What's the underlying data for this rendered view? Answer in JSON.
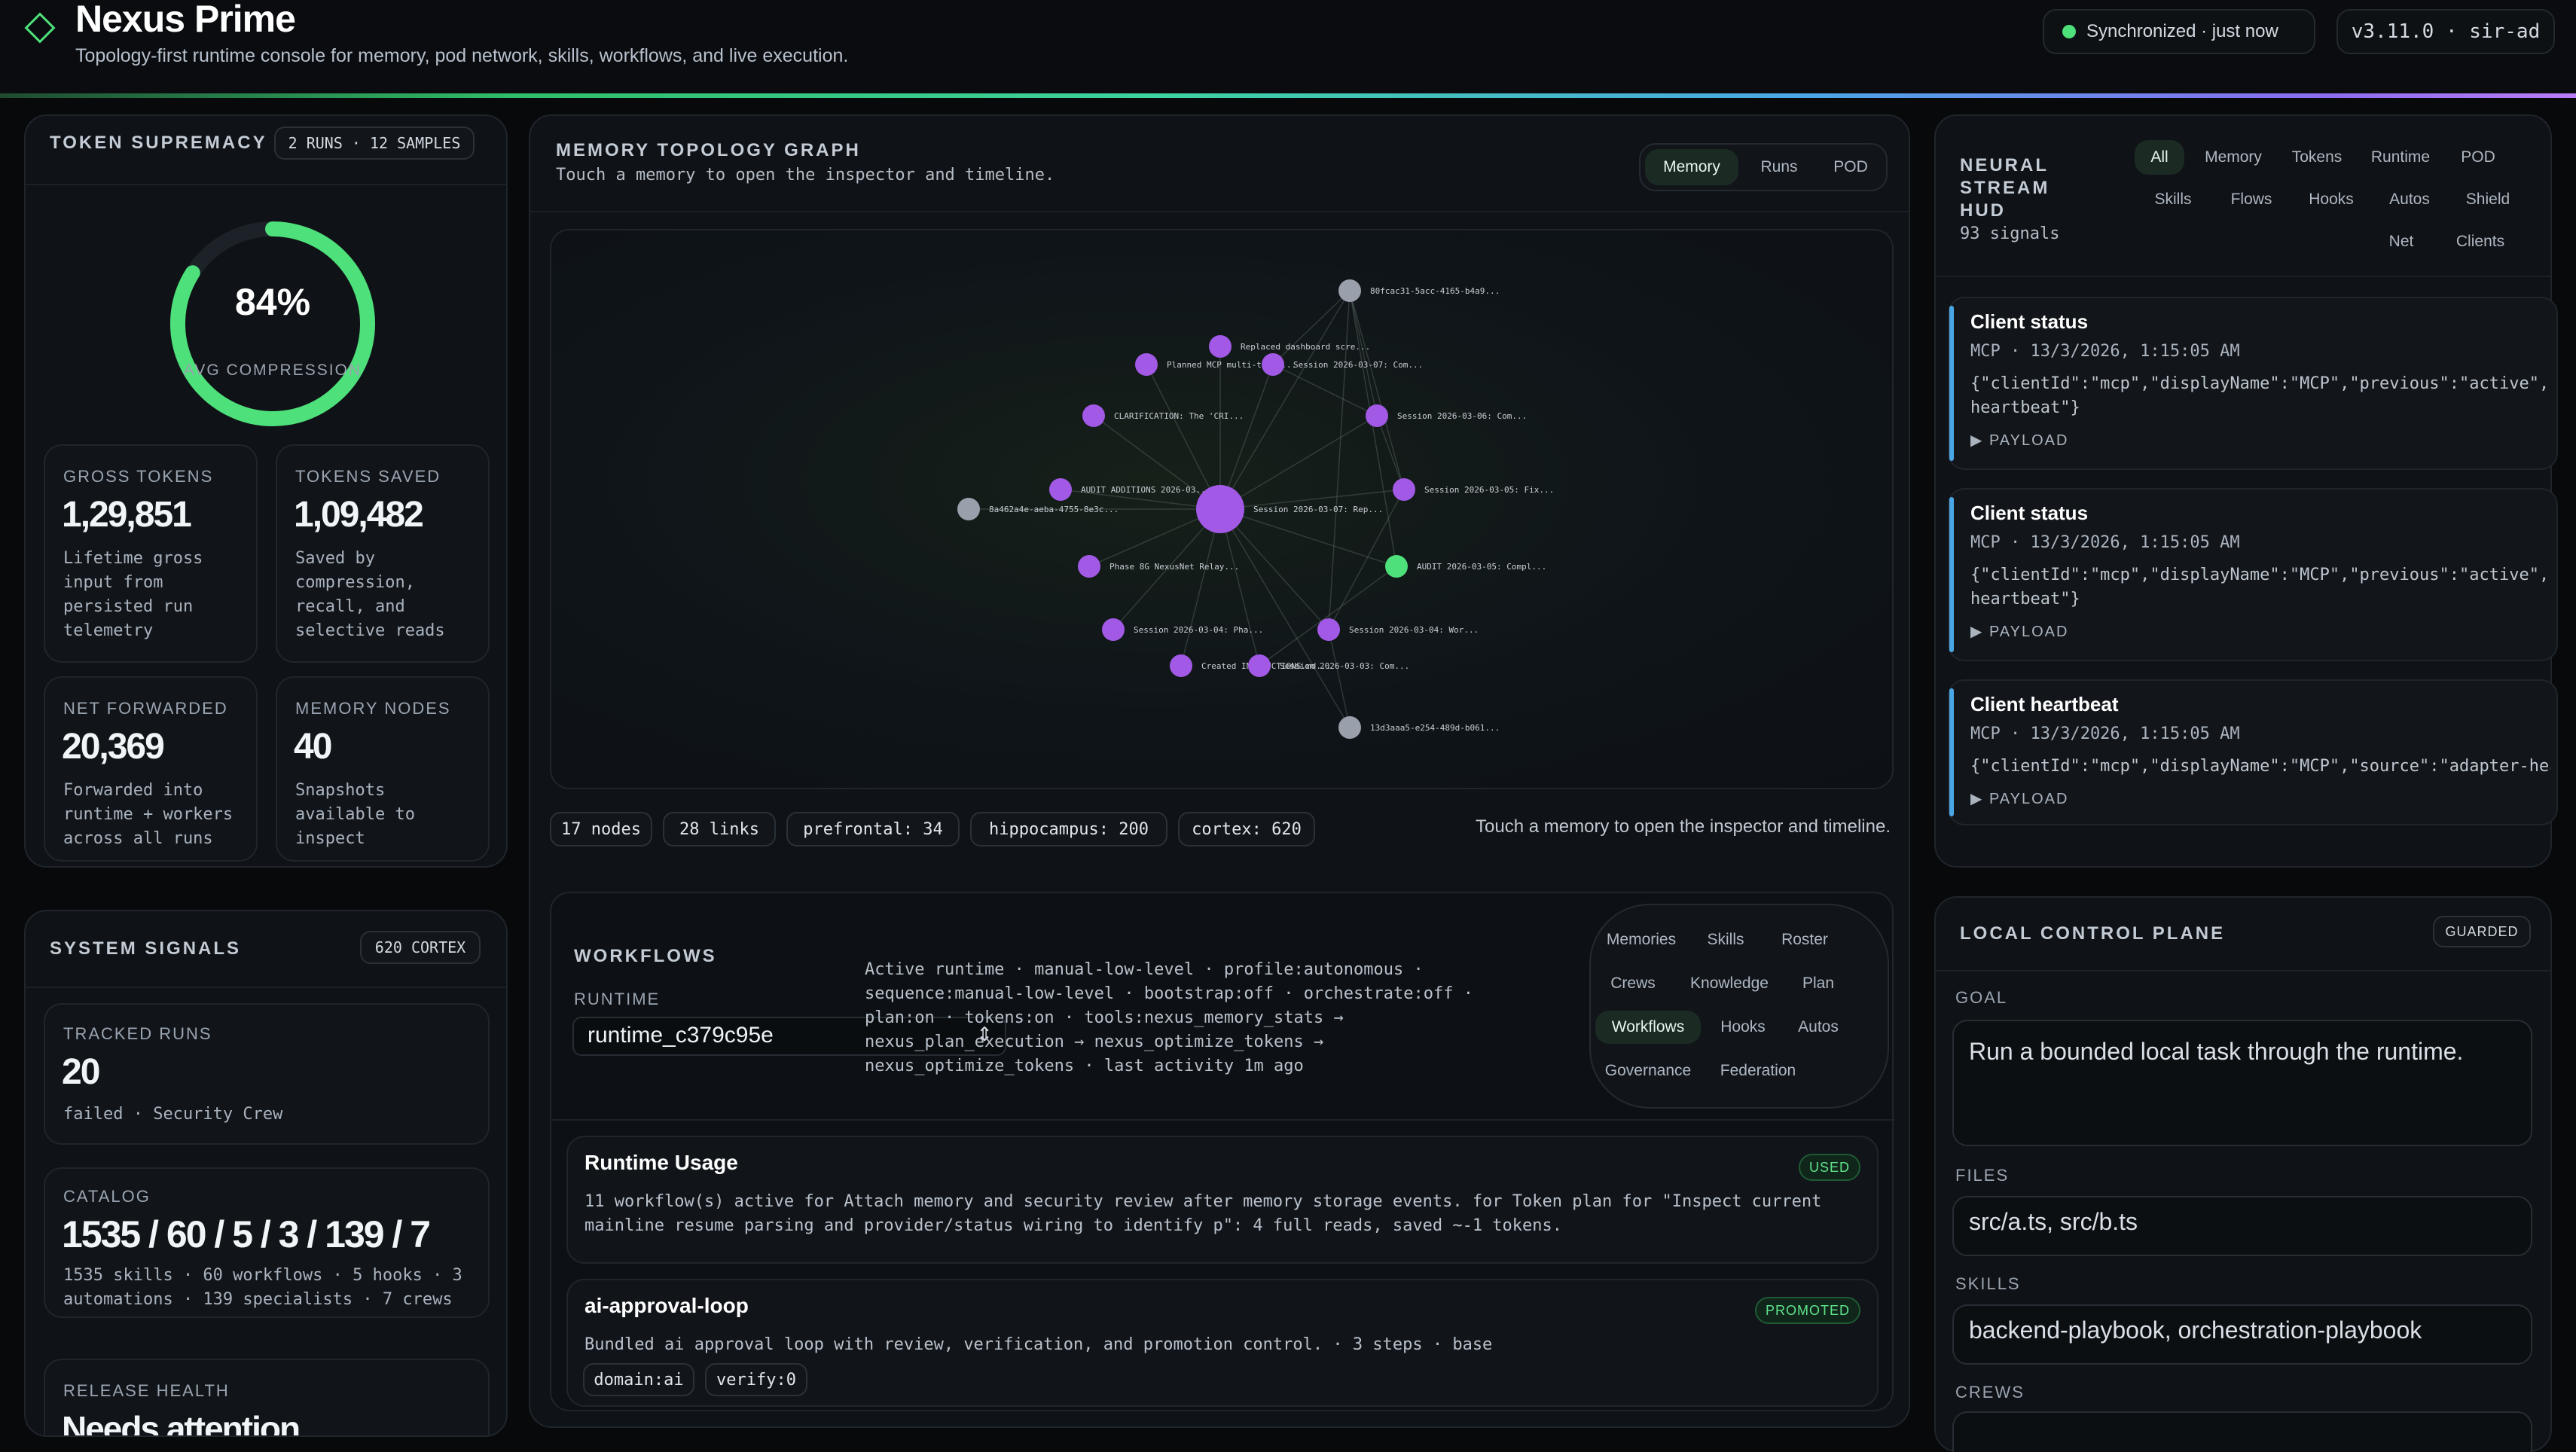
{
  "header": {
    "title": "Nexus Prime",
    "subtitle": "Topology-first runtime console for memory, pod network, skills, workflows, and live execution.",
    "sync_status": "Synchronized · just now",
    "version": "v3.11.0 · sir-ad"
  },
  "token_supremacy": {
    "title": "TOKEN SUPREMACY",
    "badge": "2 RUNS · 12 SAMPLES",
    "gauge_value": "84%",
    "gauge_fraction": 0.84,
    "gauge_label": "AVG COMPRESSION",
    "cards": [
      {
        "label": "GROSS TOKENS",
        "value": "1,29,851",
        "desc": "Lifetime gross input from persisted run telemetry"
      },
      {
        "label": "TOKENS SAVED",
        "value": "1,09,482",
        "desc": "Saved by compression, recall, and selective reads"
      },
      {
        "label": "NET FORWARDED",
        "value": "20,369",
        "desc": "Forwarded into runtime + workers across all runs"
      },
      {
        "label": "MEMORY NODES",
        "value": "40",
        "desc": "Snapshots available to inspect"
      }
    ]
  },
  "system_signals": {
    "title": "SYSTEM SIGNALS",
    "badge": "620 CORTEX",
    "tracked_runs": {
      "label": "TRACKED RUNS",
      "value": "20",
      "desc": "failed · Security Crew"
    },
    "catalog": {
      "label": "CATALOG",
      "value": "1535 / 60 / 5 / 3 / 139 / 7",
      "desc": "1535 skills · 60 workflows · 5 hooks · 3 automations · 139 specialists · 7 crews"
    },
    "release_health": {
      "label": "RELEASE HEALTH",
      "value": "Needs attention"
    }
  },
  "memory_topology": {
    "title": "MEMORY TOPOLOGY GRAPH",
    "subtitle": "Touch a memory to open the inspector and timeline.",
    "tabs": [
      "Memory",
      "Runs",
      "POD"
    ],
    "active_tab": "Memory",
    "nodes": [
      {
        "label": "80fcac31-5acc-4165-b4a9...",
        "color": "#9aa0ab"
      },
      {
        "label": "Replaced dashboard scre...",
        "color": "#a259e6"
      },
      {
        "label": "Planned MCP multi-tool ...",
        "color": "#a259e6"
      },
      {
        "label": "Session 2026-03-07: Com...",
        "color": "#a259e6"
      },
      {
        "label": "CLARIFICATION: The 'CRI...",
        "color": "#a259e6"
      },
      {
        "label": "Session 2026-03-06: Com...",
        "color": "#a259e6"
      },
      {
        "label": "AUDIT ADDITIONS 2026-03...",
        "color": "#a259e6"
      },
      {
        "label": "Session 2026-03-05: Fix...",
        "color": "#a259e6"
      },
      {
        "label": "8a462a4e-aeba-4755-8e3c...",
        "color": "#9aa0ab"
      },
      {
        "label": "Session 2026-03-07: Rep...",
        "color": "#a259e6"
      },
      {
        "label": "Phase 8G NexusNet Relay...",
        "color": "#a259e6"
      },
      {
        "label": "AUDIT 2026-03-05: Compl...",
        "color": "#4ee07a"
      },
      {
        "label": "Session 2026-03-04: Pha...",
        "color": "#a259e6"
      },
      {
        "label": "Session 2026-03-04: Wor...",
        "color": "#a259e6"
      },
      {
        "label": "Created INSTRUCTIONS.md...",
        "color": "#a259e6"
      },
      {
        "label": "Session 2026-03-03: Com...",
        "color": "#a259e6"
      },
      {
        "label": "13d3aaa5-e254-489d-b061...",
        "color": "#9aa0ab"
      }
    ],
    "stats": [
      "17 nodes",
      "28 links",
      "prefrontal: 34",
      "hippocampus: 200",
      "cortex: 620"
    ],
    "hint": "Touch a memory to open the inspector and timeline."
  },
  "workflows": {
    "title": "WORKFLOWS",
    "runtime_label": "RUNTIME",
    "runtime_value": "runtime_c379c95e",
    "runtime_info": "Active runtime · manual-low-level · profile:autonomous · sequence:manual-low-level · bootstrap:off · orchestrate:off · plan:on · tokens:on · tools:nexus_memory_stats → nexus_plan_execution → nexus_optimize_tokens → nexus_optimize_tokens · last activity 1m ago",
    "tabs": [
      "Memories",
      "Skills",
      "Roster",
      "Crews",
      "Knowledge",
      "Plan",
      "Workflows",
      "Hooks",
      "Autos",
      "Governance",
      "Federation"
    ],
    "active_tab": "Workflows",
    "items": [
      {
        "title": "Runtime Usage",
        "badge": "USED",
        "desc": "11 workflow(s) active for Attach memory and security review after memory storage events. for Token plan for \"Inspect current mainline resume parsing and provider/status wiring to identify p\": 4 full reads, saved ~-1 tokens.",
        "tags": []
      },
      {
        "title": "ai-approval-loop",
        "badge": "PROMOTED",
        "desc": "Bundled ai approval loop with review, verification, and promotion control. · 3 steps · base",
        "tags": [
          "domain:ai",
          "verify:0"
        ]
      }
    ]
  },
  "neural_stream": {
    "title_lines": [
      "NEURAL",
      "STREAM",
      "HUD"
    ],
    "count": "93 signals",
    "filters": [
      "All",
      "Memory",
      "Tokens",
      "Runtime",
      "POD",
      "Skills",
      "Flows",
      "Hooks",
      "Autos",
      "Shield",
      "Net",
      "Clients"
    ],
    "active_filter": "All",
    "payload_label": "▶ PAYLOAD",
    "events": [
      {
        "title": "Client status",
        "meta": "MCP · 13/3/2026, 1:15:05 AM",
        "json": "{\"clientId\":\"mcp\",\"displayName\":\"MCP\",\"previous\":\"active\",\"\nheartbeat\"}"
      },
      {
        "title": "Client status",
        "meta": "MCP · 13/3/2026, 1:15:05 AM",
        "json": "{\"clientId\":\"mcp\",\"displayName\":\"MCP\",\"previous\":\"active\",\"\nheartbeat\"}"
      },
      {
        "title": "Client heartbeat",
        "meta": "MCP · 13/3/2026, 1:15:05 AM",
        "json": "{\"clientId\":\"mcp\",\"displayName\":\"MCP\",\"source\":\"adapter-hea"
      }
    ]
  },
  "local_control": {
    "title": "LOCAL CONTROL PLANE",
    "badge": "GUARDED",
    "goal_label": "GOAL",
    "goal_value": "Run a bounded local task through the runtime.",
    "files_label": "FILES",
    "files_value": "src/a.ts, src/b.ts",
    "skills_label": "SKILLS",
    "skills_value": "backend-playbook, orchestration-playbook",
    "crews_label": "CREWS"
  },
  "colors": {
    "accent_green": "#4ee07a",
    "accent_purple": "#a259e6",
    "accent_blue": "#4aa7e6"
  }
}
